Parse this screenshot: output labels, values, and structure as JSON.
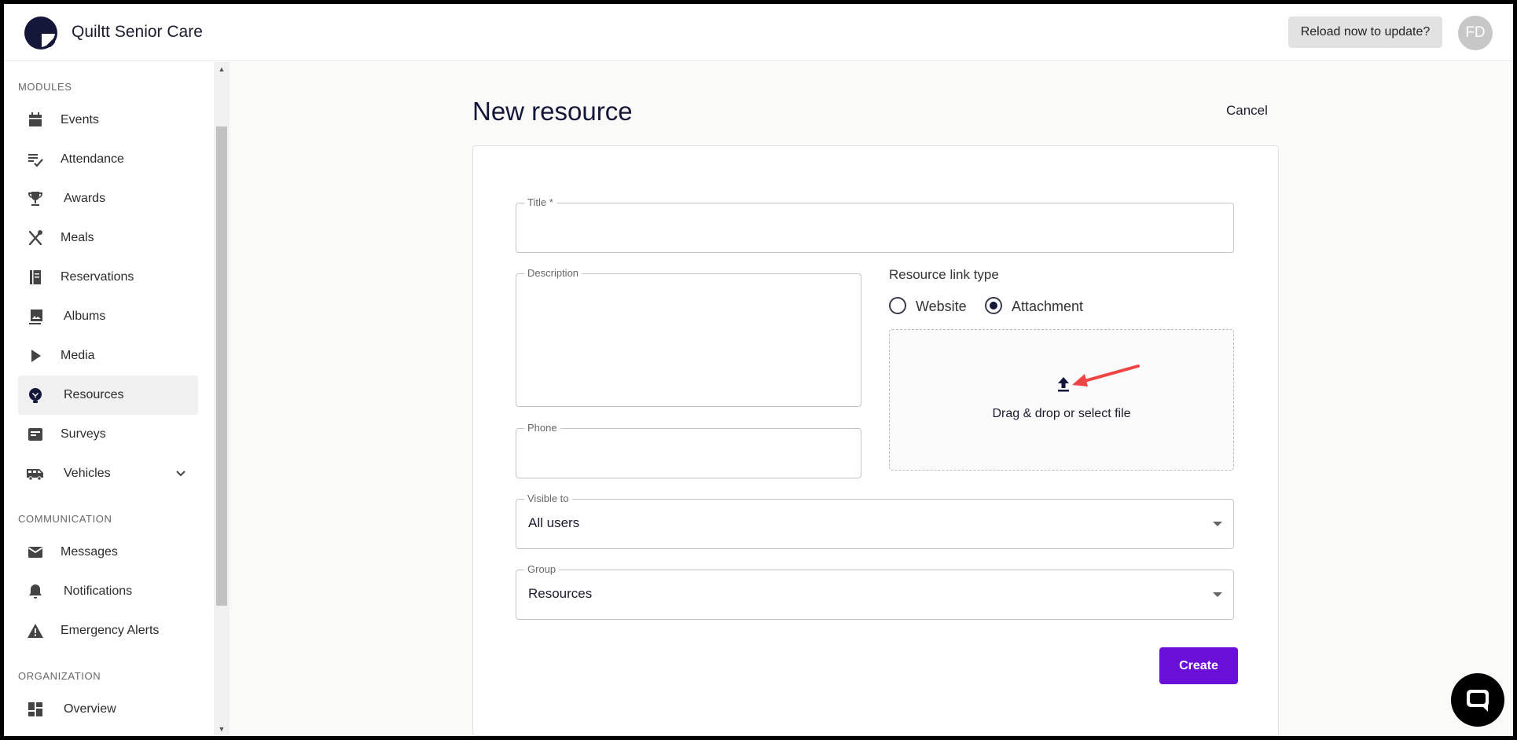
{
  "app": {
    "title": "Quiltt Senior Care",
    "reload_label": "Reload now to update?",
    "avatar_initials": "FD"
  },
  "sidebar": {
    "sections": {
      "modules": "MODULES",
      "communication": "COMMUNICATION",
      "organization": "ORGANIZATION"
    },
    "items": [
      {
        "label": "Events",
        "icon": "calendar-icon"
      },
      {
        "label": "Attendance",
        "icon": "checklist-icon"
      },
      {
        "label": "Awards",
        "icon": "trophy-icon"
      },
      {
        "label": "Meals",
        "icon": "utensils-icon"
      },
      {
        "label": "Reservations",
        "icon": "book-icon"
      },
      {
        "label": "Albums",
        "icon": "photo-icon"
      },
      {
        "label": "Media",
        "icon": "play-icon"
      },
      {
        "label": "Resources",
        "icon": "lightbulb-icon",
        "active": true
      },
      {
        "label": "Surveys",
        "icon": "survey-icon"
      },
      {
        "label": "Vehicles",
        "icon": "bus-icon",
        "expandable": true
      },
      {
        "label": "Messages",
        "icon": "mail-icon"
      },
      {
        "label": "Notifications",
        "icon": "bell-icon"
      },
      {
        "label": "Emergency Alerts",
        "icon": "warning-icon"
      },
      {
        "label": "Overview",
        "icon": "dashboard-icon"
      }
    ]
  },
  "form": {
    "page_title": "New resource",
    "cancel_label": "Cancel",
    "title_label": "Title *",
    "title_value": "",
    "description_label": "Description",
    "description_value": "",
    "phone_label": "Phone",
    "phone_value": "",
    "link_type_label": "Resource link type",
    "link_types": [
      {
        "label": "Website",
        "checked": false
      },
      {
        "label": "Attachment",
        "checked": true
      }
    ],
    "dropzone_text": "Drag & drop or select file",
    "visible_to_label": "Visible to",
    "visible_to_value": "All users",
    "group_label": "Group",
    "group_value": "Resources",
    "create_label": "Create"
  },
  "colors": {
    "primary": "#6a0fd8",
    "navy": "#14163a",
    "annotation_arrow": "#ef4444"
  }
}
